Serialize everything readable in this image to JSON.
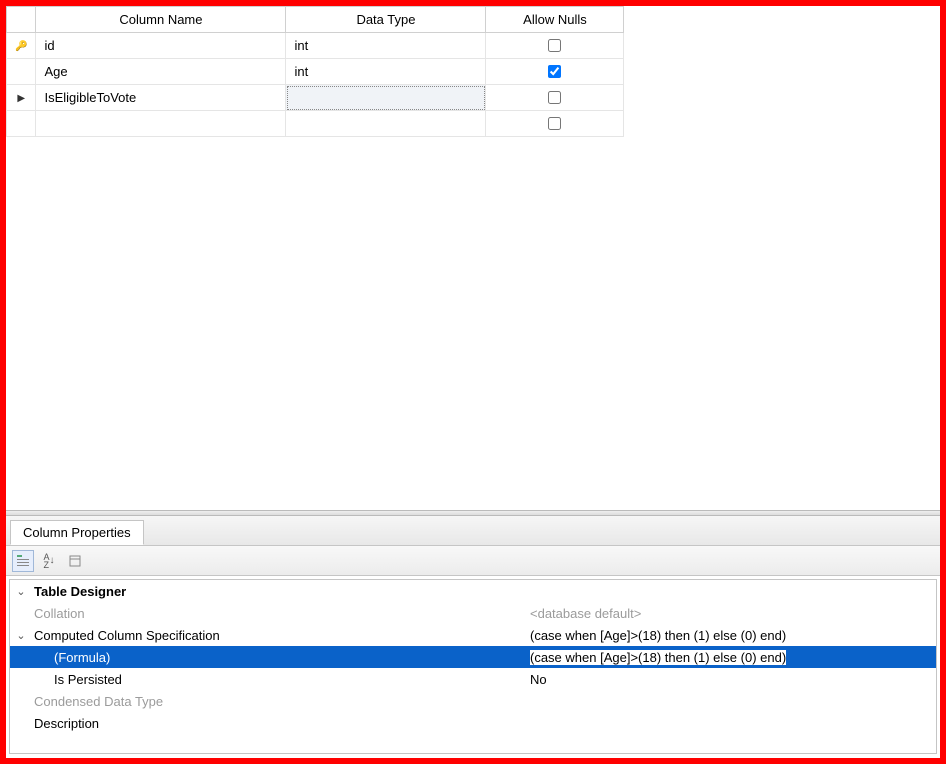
{
  "columns": {
    "header_name": "Column Name",
    "header_type": "Data Type",
    "header_null": "Allow Nulls",
    "rows": [
      {
        "key": true,
        "arrow": false,
        "name": "id",
        "type": "int",
        "allow_null": false
      },
      {
        "key": false,
        "arrow": false,
        "name": "Age",
        "type": "int",
        "allow_null": true
      },
      {
        "key": false,
        "arrow": true,
        "name": "IsEligibleToVote",
        "type": "",
        "allow_null": false,
        "type_active": true
      },
      {
        "key": false,
        "arrow": false,
        "name": "",
        "type": "",
        "allow_null": false
      }
    ]
  },
  "tab_label": "Column Properties",
  "props": {
    "header": "Table Designer",
    "collation_label": "Collation",
    "collation_value": "<database default>",
    "ccs_label": "Computed Column Specification",
    "ccs_value": "(case when [Age]>(18) then (1) else (0) end)",
    "formula_label": "(Formula)",
    "formula_value": "(case when [Age]>(18) then (1) else (0) end)",
    "persisted_label": "Is Persisted",
    "persisted_value": "No",
    "condensed_label": "Condensed Data Type",
    "description_label": "Description"
  }
}
